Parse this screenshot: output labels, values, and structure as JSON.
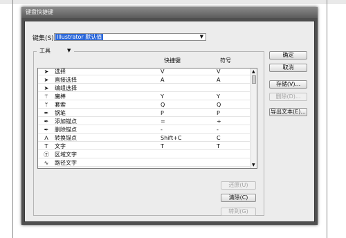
{
  "dialog": {
    "title": "键盘快捷键"
  },
  "set": {
    "label": "键集(S):",
    "value": "Illustrator 默认值"
  },
  "category": {
    "value": "工具"
  },
  "columns": {
    "shortcut": "快捷键",
    "symbol": "符号"
  },
  "tools": [
    {
      "icon": "selection-arrow-icon",
      "glyph": "➤",
      "name": "选择",
      "shortcut": "V",
      "symbol": "V"
    },
    {
      "icon": "direct-selection-icon",
      "glyph": "➤",
      "name": "直接选择",
      "shortcut": "A",
      "symbol": "A"
    },
    {
      "icon": "group-selection-icon",
      "glyph": "➤",
      "name": "编组选择",
      "shortcut": "",
      "symbol": ""
    },
    {
      "icon": "magic-wand-icon",
      "glyph": "⚚",
      "name": "魔棒",
      "shortcut": "Y",
      "symbol": "Y"
    },
    {
      "icon": "lasso-icon",
      "glyph": "ᛘ",
      "name": "套索",
      "shortcut": "Q",
      "symbol": "Q"
    },
    {
      "icon": "pen-icon",
      "glyph": "✒",
      "name": "钢笔",
      "shortcut": "P",
      "symbol": "P"
    },
    {
      "icon": "add-anchor-icon",
      "glyph": "✒",
      "name": "添加锚点",
      "shortcut": "=",
      "symbol": "+"
    },
    {
      "icon": "delete-anchor-icon",
      "glyph": "✒",
      "name": "删除锚点",
      "shortcut": "-",
      "symbol": "-"
    },
    {
      "icon": "convert-anchor-icon",
      "glyph": "ᐱ",
      "name": "转换锚点",
      "shortcut": "Shift+C",
      "symbol": "C"
    },
    {
      "icon": "type-icon",
      "glyph": "T",
      "name": "文字",
      "shortcut": "T",
      "symbol": "T"
    },
    {
      "icon": "area-type-icon",
      "glyph": "Ⓣ",
      "name": "区域文字",
      "shortcut": "",
      "symbol": ""
    },
    {
      "icon": "path-type-icon",
      "glyph": "∿",
      "name": "路径文字",
      "shortcut": "",
      "symbol": ""
    }
  ],
  "buttons": {
    "ok": "确定",
    "cancel": "取消",
    "save": "存储(V)...",
    "delete": "删除(D)...",
    "export_text": "导出文本(E)...",
    "undo": "还原(U)",
    "clear": "清除(C)",
    "goto": "转到(G)"
  }
}
